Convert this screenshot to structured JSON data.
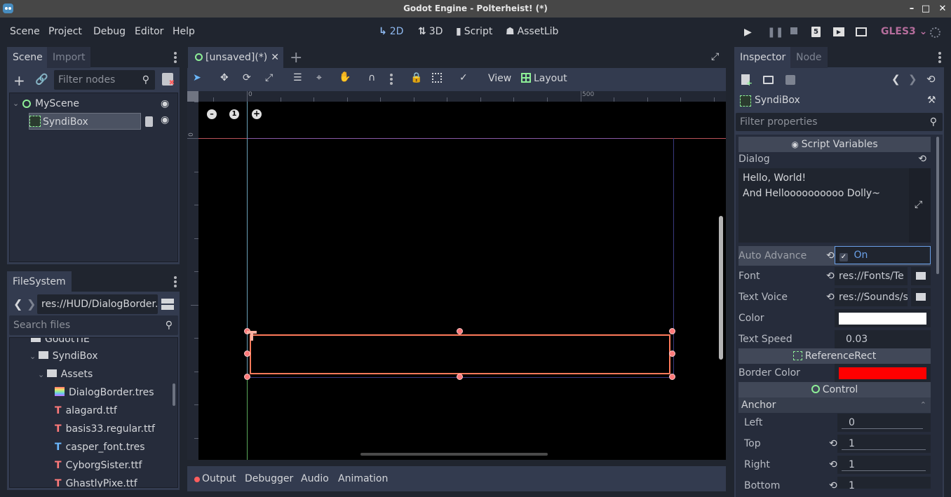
{
  "window": {
    "title": "Godot Engine - Polterheist! (*)",
    "controls": [
      "minimize-icon",
      "maximize-icon",
      "close-icon"
    ]
  },
  "menu": {
    "items": [
      "Scene",
      "Project",
      "Debug",
      "Editor",
      "Help"
    ]
  },
  "workspaces": [
    {
      "label": "2D",
      "icon": "2d-axes-icon",
      "active": true
    },
    {
      "label": "3D",
      "icon": "3d-axes-icon",
      "active": false
    },
    {
      "label": "Script",
      "icon": "script-icon",
      "active": false
    },
    {
      "label": "AssetLib",
      "icon": "assetlib-bag-icon",
      "active": false
    }
  ],
  "run_controls": [
    "play-icon",
    "pause-icon",
    "stop-icon",
    "html5-icon",
    "play-scene-icon",
    "play-custom-scene-icon"
  ],
  "renderer": {
    "label": "GLES3",
    "color": "#b56d9c"
  },
  "scene_dock": {
    "tabs": [
      "Scene",
      "Import"
    ],
    "filter_placeholder": "Filter nodes",
    "tree": [
      {
        "name": "MyScene",
        "icon": "control-circle-icon",
        "visible": true
      },
      {
        "name": "SyndiBox",
        "icon": "syndibox-node-icon",
        "visible": true,
        "selected": true,
        "has_script": true
      }
    ]
  },
  "filesystem_dock": {
    "tab": "FileSystem",
    "path": "res://HUD/DialogBorder.",
    "search_placeholder": "Search files",
    "items": [
      {
        "name": "GodotTIE",
        "type": "folder",
        "expanded": false
      },
      {
        "name": "SyndiBox",
        "type": "folder",
        "expanded": true
      },
      {
        "name": "Assets",
        "type": "folder",
        "expanded": true
      },
      {
        "name": "DialogBorder.tres",
        "type": "stylebox"
      },
      {
        "name": "alagard.ttf",
        "type": "font"
      },
      {
        "name": "basis33.regular.ttf",
        "type": "font"
      },
      {
        "name": "casper_font.tres",
        "type": "font-resource"
      },
      {
        "name": "CyborgSister.ttf",
        "type": "font"
      },
      {
        "name": "GhastlyPixe.ttf",
        "type": "font"
      }
    ]
  },
  "editor": {
    "scene_tab": "[unsaved](*)",
    "toolbar": {
      "view_label": "View",
      "layout_label": "Layout"
    },
    "ruler": {
      "h_labels": [
        "0",
        "500"
      ],
      "v_labels": [
        "0"
      ]
    },
    "zoom_controls": [
      "zoom-out-icon",
      "zoom-reset-icon",
      "zoom-in-icon"
    ]
  },
  "bottom_panel": {
    "tabs": [
      "Output",
      "Debugger",
      "Audio",
      "Animation"
    ]
  },
  "inspector": {
    "tabs": [
      "Inspector",
      "Node"
    ],
    "node_name": "SyndiBox",
    "filter_placeholder": "Filter properties",
    "sections": {
      "script_variables": "Script Variables",
      "reference_rect": "ReferenceRect",
      "control": "Control",
      "anchor": "Anchor"
    },
    "dialog": {
      "label": "Dialog",
      "lines": [
        "Hello, World!",
        "And Helloooooooooo Dolly~"
      ]
    },
    "auto_advance": {
      "label": "Auto Advance",
      "value": "On",
      "checked": true
    },
    "font": {
      "label": "Font",
      "value": "res://Fonts/Te"
    },
    "text_voice": {
      "label": "Text Voice",
      "value": "res://Sounds/s"
    },
    "color": {
      "label": "Color",
      "value": "#ffffff"
    },
    "text_speed": {
      "label": "Text Speed",
      "value": "0.03"
    },
    "border_color": {
      "label": "Border Color",
      "value": "#ff0000"
    },
    "anchor": [
      {
        "label": "Left",
        "value": "0"
      },
      {
        "label": "Top",
        "value": "1"
      },
      {
        "label": "Right",
        "value": "1"
      },
      {
        "label": "Bottom",
        "value": "1"
      }
    ]
  }
}
